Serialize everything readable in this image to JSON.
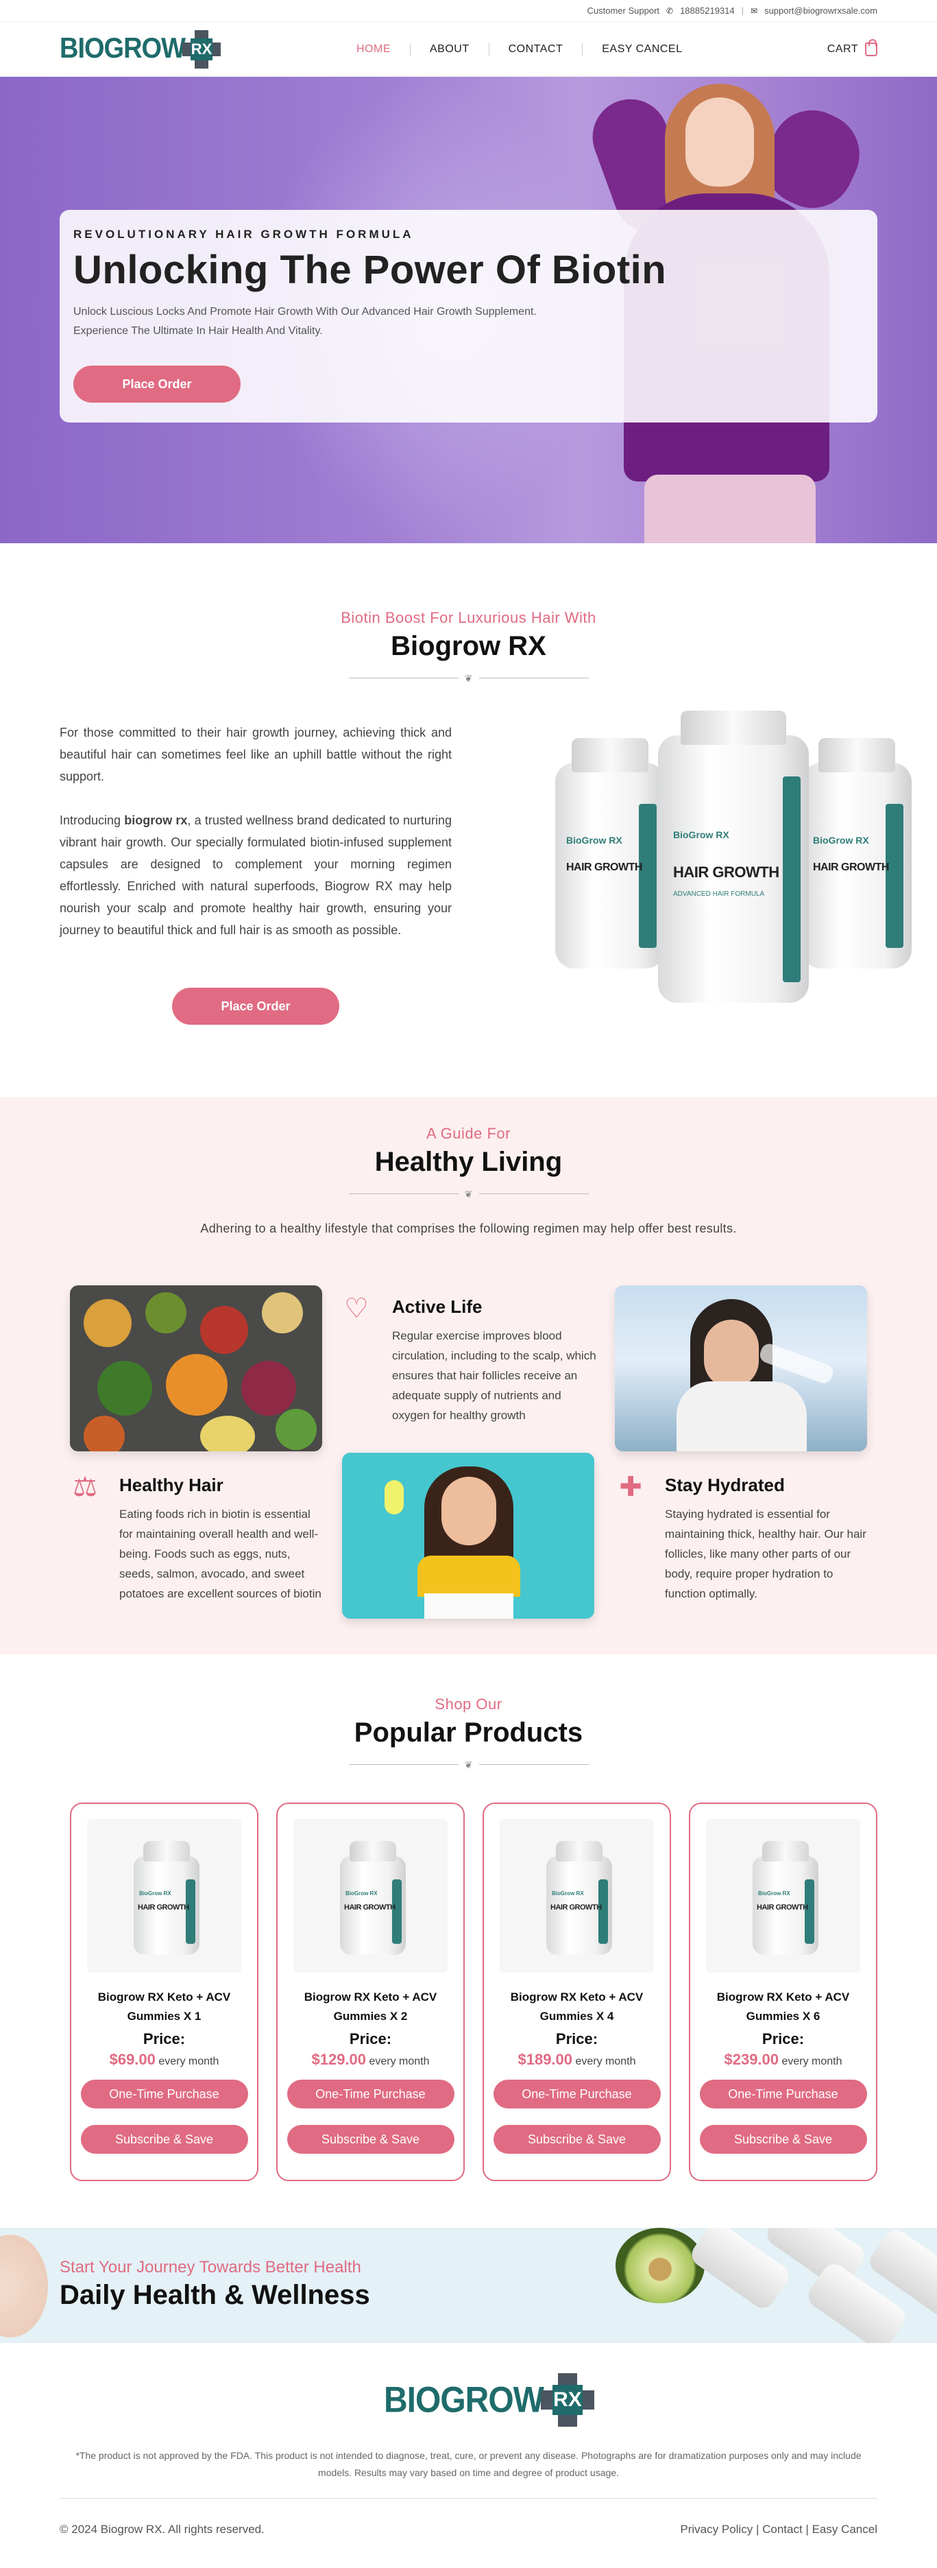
{
  "topbar": {
    "support_label": "Customer Support",
    "phone": "18885219314",
    "email": "support@biogrowrxsale.com"
  },
  "brand": {
    "logo_text": "BIOGROW",
    "logo_mark": "RX",
    "accent_color": "#e06b82",
    "brand_color": "#1f6b6b"
  },
  "nav": {
    "items": [
      {
        "label": "HOME",
        "active": true
      },
      {
        "label": "ABOUT"
      },
      {
        "label": "CONTACT"
      },
      {
        "label": "EASY CANCEL"
      }
    ],
    "cart_label": "CART",
    "cart_icon": "shopping-bag-icon"
  },
  "hero": {
    "kicker": "REVOLUTIONARY HAIR GROWTH FORMULA",
    "title": "Unlocking The Power Of Biotin",
    "text": "Unlock Luscious Locks And Promote Hair Growth With Our Advanced Hair Growth Supplement. Experience The Ultimate In Hair Health And Vitality.",
    "button": "Place Order"
  },
  "intro": {
    "subheading": "Biotin Boost For Luxurious Hair With",
    "heading": "Biogrow RX",
    "para1": "For those committed to their hair growth journey, achieving thick and beautiful  hair can sometimes feel like an uphill battle without the right support.",
    "para2_prefix": "Introducing ",
    "para2_brand": "biogrow rx",
    "para2_rest": ", a trusted wellness brand dedicated to nurturing vibrant hair growth. Our specially formulated biotin-infused supplement capsules are designed to complement your morning regimen effortlessly. Enriched with natural superfoods, Biogrow RX may help nourish your scalp and promote healthy hair growth, ensuring your journey to beautiful thick and full hair is as smooth as possible.",
    "button": "Place Order",
    "bottle_brand": "BioGrow RX",
    "bottle_name": "HAIR GROWTH",
    "bottle_sub": "ADVANCED HAIR FORMULA"
  },
  "guide": {
    "subheading": "A Guide For",
    "heading": "Healthy Living",
    "lead": "Adhering to a healthy lifestyle that comprises the following regimen may help offer best results.",
    "active_life": {
      "title": "Active Life",
      "text": "Regular exercise improves blood circulation, including to the scalp, which ensures that hair follicles receive an adequate supply of nutrients and oxygen for healthy growth",
      "icon": "heart-pulse-icon"
    },
    "healthy_hair": {
      "title": "Healthy Hair",
      "text": "Eating foods rich in biotin is essential for maintaining overall health and well-being. Foods such as eggs, nuts, seeds, salmon, avocado, and sweet potatoes are excellent sources of biotin",
      "icon": "kettlebell-icon"
    },
    "stay_hydrated": {
      "title": "Stay Hydrated",
      "text": "Staying hydrated is essential for maintaining thick, healthy hair. Our hair follicles, like many other parts of our body, require proper hydration to function optimally.",
      "icon": "medical-cross-icon"
    }
  },
  "products": {
    "subheading": "Shop Our",
    "heading": "Popular Products",
    "price_label": "Price:",
    "per_month": "every month",
    "btn_one_time": "One-Time Purchase",
    "btn_subscribe": "Subscribe & Save",
    "items": [
      {
        "name": "Biogrow RX Keto + ACV Gummies X 1",
        "price": "$69.00"
      },
      {
        "name": "Biogrow RX Keto + ACV Gummies X 2",
        "price": "$129.00"
      },
      {
        "name": "Biogrow RX Keto + ACV Gummies X 4",
        "price": "$189.00"
      },
      {
        "name": "Biogrow RX Keto + ACV Gummies X 6",
        "price": "$239.00"
      }
    ]
  },
  "banner": {
    "sub": "Start Your Journey Towards Better Health",
    "title": "Daily Health & Wellness"
  },
  "footer": {
    "disclaimer": "*The product is not approved by the FDA. This product is not intended to diagnose, treat, cure, or prevent any disease. Photographs are for dramatization purposes only and may include models. Results may vary based on time and degree of product usage.",
    "copyright": "© 2024 Biogrow RX. All rights reserved.",
    "links": [
      "Privacy Policy",
      "Contact",
      "Easy Cancel"
    ]
  }
}
